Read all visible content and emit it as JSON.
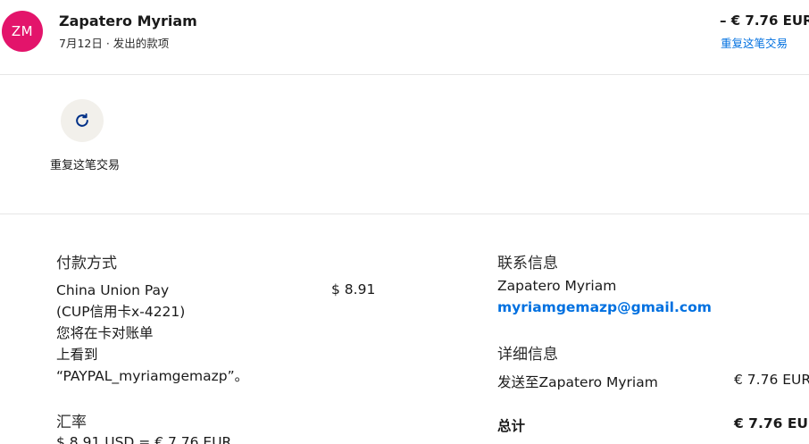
{
  "header": {
    "avatar_initials": "ZM",
    "name": "Zapatero Myriam",
    "subline": "7月12日 · 发出的款项",
    "amount": "– € 7.76 EUR",
    "repeat_link": "重复这笔交易"
  },
  "actions": {
    "repeat_icon": "refresh-icon",
    "repeat_label": "重复这笔交易"
  },
  "payment": {
    "title": "付款方式",
    "method_lines": [
      "China Union Pay",
      "(CUP信用卡x-4221)",
      "您将在卡对账单",
      "上看到",
      "“PAYPAL_myriamgemazp”。"
    ],
    "amount": "$ 8.91"
  },
  "exchange": {
    "title": "汇率",
    "rate": "$ 8.91 USD = € 7.76 EUR"
  },
  "contact": {
    "title": "联系信息",
    "name": "Zapatero Myriam",
    "email": "myriamgemazp@gmail.com"
  },
  "details": {
    "title": "详细信息",
    "sent_to_label": "发送至Zapatero Myriam",
    "sent_to_amount": "€ 7.76 EUR",
    "total_label": "总计",
    "total_amount": "€ 7.76 EUR"
  },
  "colors": {
    "avatar": "#e3146b",
    "link": "#0070e0",
    "icon_bg": "#f2f0eb"
  }
}
